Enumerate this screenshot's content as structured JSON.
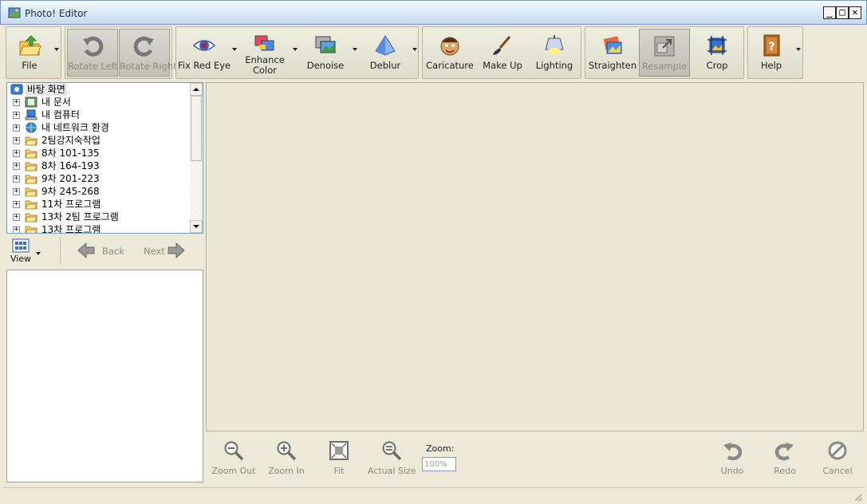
{
  "window": {
    "title": "Photo! Editor"
  },
  "toolbar": {
    "file": "File",
    "rotate_left": "Rotate Left",
    "rotate_right": "Rotate Right",
    "fix_red_eye": "Fix Red Eye",
    "enhance_color": "Enhance Color",
    "denoise": "Denoise",
    "deblur": "Deblur",
    "caricature": "Caricature",
    "make_up": "Make Up",
    "lighting": "Lighting",
    "straighten": "Straighten",
    "resample": "Resample",
    "crop": "Crop",
    "help": "Help"
  },
  "tree": {
    "root": "바탕 화면",
    "items": [
      {
        "label": "내 문서",
        "icon": "documents-icon"
      },
      {
        "label": "내 컴퓨터",
        "icon": "computer-icon"
      },
      {
        "label": "내 네트워크 환경",
        "icon": "network-icon"
      },
      {
        "label": "2팀강지숙작업",
        "icon": "folder-icon"
      },
      {
        "label": "8차 101-135",
        "icon": "folder-icon"
      },
      {
        "label": "8차 164-193",
        "icon": "folder-icon"
      },
      {
        "label": "9차 201-223",
        "icon": "folder-icon"
      },
      {
        "label": "9차 245-268",
        "icon": "folder-icon"
      },
      {
        "label": "11차 프로그램",
        "icon": "folder-icon"
      },
      {
        "label": "13차 2팀 프로그램",
        "icon": "folder-icon"
      },
      {
        "label": "13차 프로그램",
        "icon": "folder-icon"
      }
    ]
  },
  "nav": {
    "view": "View",
    "back": "Back",
    "next": "Next"
  },
  "bottom": {
    "zoom_out": "Zoom Out",
    "zoom_in": "Zoom In",
    "fit": "Fit",
    "actual_size": "Actual Size",
    "zoom_label": "Zoom:",
    "zoom_value": "100%",
    "undo": "Undo",
    "redo": "Redo",
    "cancel": "Cancel"
  },
  "colors": {
    "accent": "#2d5aa8",
    "panel": "#ece9d8",
    "canvas": "#ebe8d7"
  }
}
